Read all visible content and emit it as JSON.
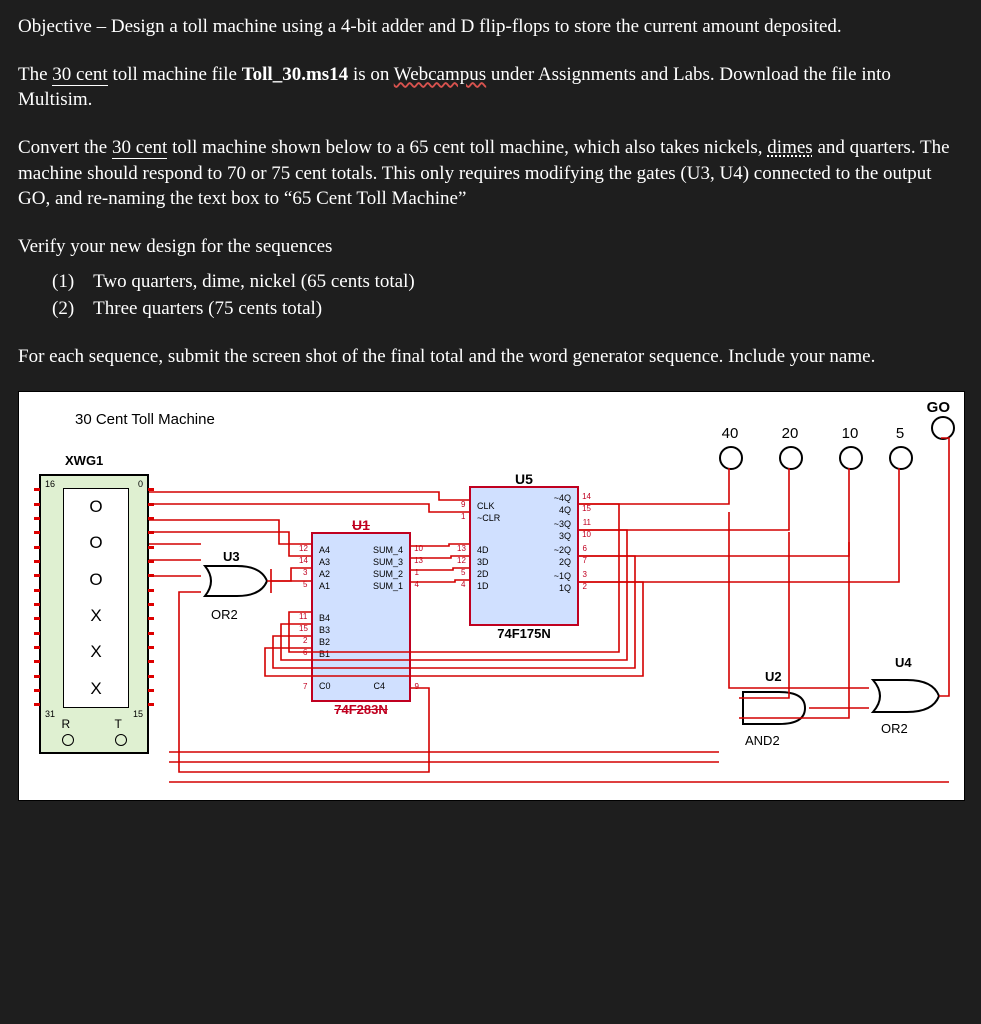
{
  "text": {
    "objective_prefix": "Objective – ",
    "objective_body": "Design a toll machine using a 4-bit adder and D flip-flops to store the current amount deposited.",
    "p2a": "The ",
    "thirtycent": "30 cent",
    "p2b": " toll machine file ",
    "filename": "Toll_30.ms14",
    "p2c": " is on ",
    "webcampus": "Webcampus",
    "p2d": " under Assignments and Labs. Download the file into Multisim.",
    "p3a": "Convert the ",
    "p3b": " toll machine shown below to a 65 cent toll machine, which also takes nickels, ",
    "dimes": "dimes",
    "p3c": " and quarters. The machine should respond to 70 or 75 cent totals. This only requires modifying the gates  (U3, U4) connected to the output GO, and re-naming the text box to “65 Cent Toll Machine”",
    "verify": "Verify your new design for the sequences",
    "seq1": "(1) Two quarters, dime, nickel (65 cents total)",
    "seq2": "(2) Three quarters (75 cents total)",
    "p5": "For each sequence, submit the screen shot of the final total and the word generator sequence. Include your name."
  },
  "figure": {
    "title": "30 Cent Toll Machine",
    "xwg_name": "XWG1",
    "go": "GO",
    "probe_labels": [
      "40",
      "20",
      "10",
      "5"
    ],
    "xwg_rows": [
      "O",
      "O",
      "O",
      "X",
      "X",
      "X"
    ],
    "xwg_corners": {
      "tl": "16",
      "tr": "0",
      "bl": "31",
      "br": "15"
    },
    "xwg_rt": [
      "R",
      "T"
    ],
    "u1": {
      "name": "U1",
      "part": "74F283N",
      "left_a": [
        "A4",
        "A3",
        "A2",
        "A1"
      ],
      "left_a_pins": [
        "12",
        "14",
        "3",
        "5"
      ],
      "right_s": [
        "SUM_4",
        "SUM_3",
        "SUM_2",
        "SUM_1"
      ],
      "right_s_pins": [
        "10",
        "13",
        "1",
        "4"
      ],
      "left_b": [
        "B4",
        "B3",
        "B2",
        "B1"
      ],
      "left_b_pins": [
        "11",
        "15",
        "2",
        "6"
      ],
      "c0": "C0",
      "c0_pin": "7",
      "c4": "C4",
      "c4_pin": "9"
    },
    "u5": {
      "name": "U5",
      "part": "74F175N",
      "ctrl": [
        "CLK",
        "~CLR"
      ],
      "ctrl_pins": [
        "9",
        "1"
      ],
      "d": [
        "4D",
        "3D",
        "2D",
        "1D"
      ],
      "d_pins": [
        "13",
        "12",
        "5",
        "4"
      ],
      "q": [
        "~4Q",
        "4Q",
        "~3Q",
        "3Q",
        "~2Q",
        "2Q",
        "~1Q",
        "1Q"
      ],
      "q_pins": [
        "14",
        "15",
        "11",
        "10",
        "6",
        "7",
        "3",
        "2"
      ]
    },
    "u2": {
      "name": "U2",
      "type": "AND2"
    },
    "u3": {
      "name": "U3",
      "type": "OR2"
    },
    "u4": {
      "name": "U4",
      "type": "OR2"
    }
  }
}
